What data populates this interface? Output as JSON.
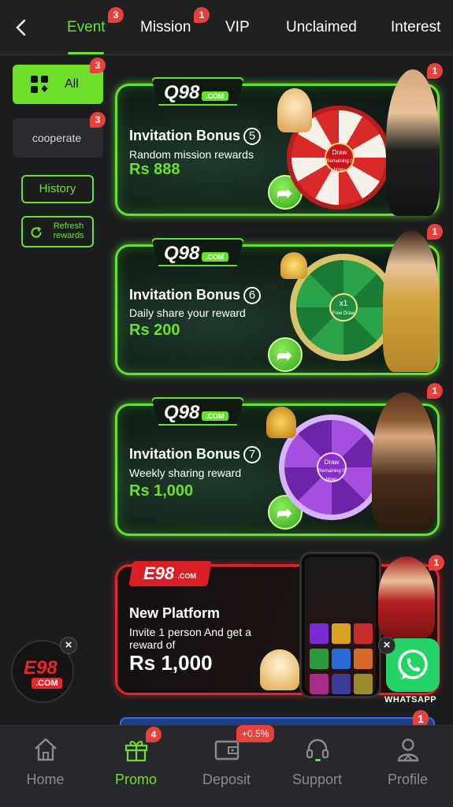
{
  "colors": {
    "accent": "#6ee02c",
    "badge": "#e8403a",
    "background": "#1c1d1f",
    "navbar": "#27282b",
    "e98_red": "#e0262a",
    "whatsapp": "#25d366"
  },
  "header": {
    "back_icon": "chevron-left-icon",
    "tabs": [
      {
        "label": "Event",
        "badge": "3",
        "active": true
      },
      {
        "label": "Mission",
        "badge": "1",
        "active": false
      },
      {
        "label": "VIP",
        "badge": "",
        "active": false
      },
      {
        "label": "Unclaimed",
        "badge": "",
        "active": false
      },
      {
        "label": "Interest",
        "badge": "",
        "active": false
      }
    ]
  },
  "sidebar": {
    "all": {
      "label": "All",
      "badge": "3",
      "icon": "grid-apps-icon"
    },
    "cooperate": {
      "label": "cooperate",
      "badge": "3"
    },
    "history_label": "History",
    "refresh_label": "Refresh rewards"
  },
  "cards": [
    {
      "logo": "Q98",
      "logo_suffix": ".COM",
      "title": "Invitation Bonus",
      "number": "5",
      "subtitle": "Random mission rewards",
      "amount": "Rs 888",
      "badge": "1",
      "wheel_center": "Draw",
      "wheel_center_sub": "Remaining 0 times"
    },
    {
      "logo": "Q98",
      "logo_suffix": ".COM",
      "title": "Invitation Bonus",
      "number": "6",
      "subtitle": "Daily share your reward",
      "amount": "Rs 200",
      "badge": "1",
      "wheel_center": "x1",
      "wheel_center_sub": "Free Draw"
    },
    {
      "logo": "Q98",
      "logo_suffix": ".COM",
      "title": "Invitation Bonus",
      "number": "7",
      "subtitle": "Weekly sharing reward",
      "amount": "Rs 1,000",
      "badge": "1",
      "wheel_center": "Draw",
      "wheel_center_sub": "Remaining 0 times"
    },
    {
      "logo": "E98",
      "logo_suffix": ".COM",
      "title": "New Platform",
      "subtitle": "Invite 1 person And get a reward of",
      "amount": "Rs 1,000",
      "badge": "1"
    }
  ],
  "floating": {
    "e98_logo": "E98",
    "e98_suffix": ".COM",
    "whatsapp_label": "WHATSAPP",
    "close_glyph": "×",
    "peek_badge": "1"
  },
  "nav": {
    "items": [
      {
        "label": "Home",
        "icon": "home-icon",
        "badge": ""
      },
      {
        "label": "Promo",
        "icon": "gift-icon",
        "badge": "4",
        "active": true
      },
      {
        "label": "Deposit",
        "icon": "wallet-icon",
        "badge": "+0.5%"
      },
      {
        "label": "Support",
        "icon": "headset-icon",
        "badge": ""
      },
      {
        "label": "Profile",
        "icon": "user-icon",
        "badge": ""
      }
    ]
  }
}
